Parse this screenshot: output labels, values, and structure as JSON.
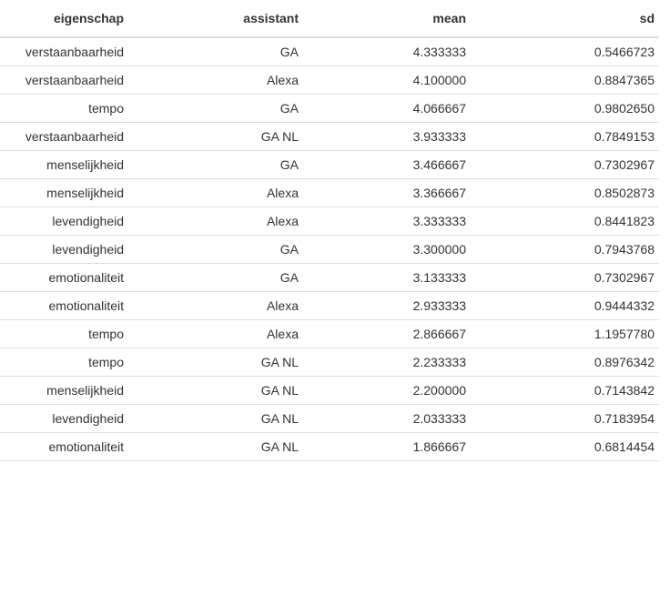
{
  "table": {
    "headers": [
      "eigenschap",
      "assistant",
      "mean",
      "sd"
    ],
    "rows": [
      [
        "verstaanbaarheid",
        "GA",
        "4.333333",
        "0.5466723"
      ],
      [
        "verstaanbaarheid",
        "Alexa",
        "4.100000",
        "0.8847365"
      ],
      [
        "tempo",
        "GA",
        "4.066667",
        "0.9802650"
      ],
      [
        "verstaanbaarheid",
        "GA NL",
        "3.933333",
        "0.7849153"
      ],
      [
        "menselijkheid",
        "GA",
        "3.466667",
        "0.7302967"
      ],
      [
        "menselijkheid",
        "Alexa",
        "3.366667",
        "0.8502873"
      ],
      [
        "levendigheid",
        "Alexa",
        "3.333333",
        "0.8441823"
      ],
      [
        "levendigheid",
        "GA",
        "3.300000",
        "0.7943768"
      ],
      [
        "emotionaliteit",
        "GA",
        "3.133333",
        "0.7302967"
      ],
      [
        "emotionaliteit",
        "Alexa",
        "2.933333",
        "0.9444332"
      ],
      [
        "tempo",
        "Alexa",
        "2.866667",
        "1.1957780"
      ],
      [
        "tempo",
        "GA NL",
        "2.233333",
        "0.8976342"
      ],
      [
        "menselijkheid",
        "GA NL",
        "2.200000",
        "0.7143842"
      ],
      [
        "levendigheid",
        "GA NL",
        "2.033333",
        "0.7183954"
      ],
      [
        "emotionaliteit",
        "GA NL",
        "1.866667",
        "0.6814454"
      ]
    ]
  }
}
